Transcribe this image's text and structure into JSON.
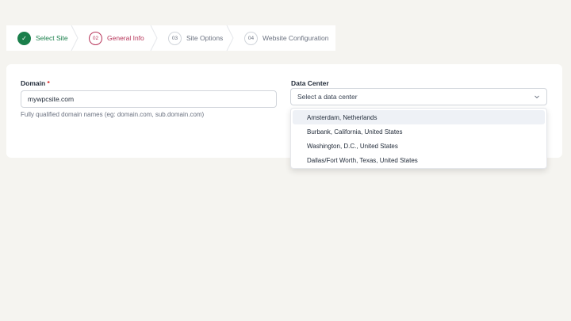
{
  "stepper": {
    "steps": [
      {
        "number": "✓",
        "label": "Select Site",
        "state": "done"
      },
      {
        "number": "02",
        "label": "General Info",
        "state": "active"
      },
      {
        "number": "03",
        "label": "Site Options",
        "state": "pending"
      },
      {
        "number": "04",
        "label": "Website Configuration",
        "state": "pending"
      }
    ]
  },
  "form": {
    "domain": {
      "label": "Domain",
      "required_mark": "*",
      "value": "mywpcsite.com",
      "hint": "Fully qualified domain names (eg: domain.com, sub.domain.com)"
    },
    "data_center": {
      "label": "Data Center",
      "placeholder": "Select a data center",
      "options": [
        "Amsterdam, Netherlands",
        "Burbank, California, United States",
        "Washington, D.C., United States",
        "Dallas/Fort Worth, Texas, United States"
      ]
    }
  },
  "colors": {
    "background": "#f5f4f0",
    "done_green": "#1a7f4b",
    "active_accent": "#b7355a",
    "required_red": "#dc2626"
  }
}
